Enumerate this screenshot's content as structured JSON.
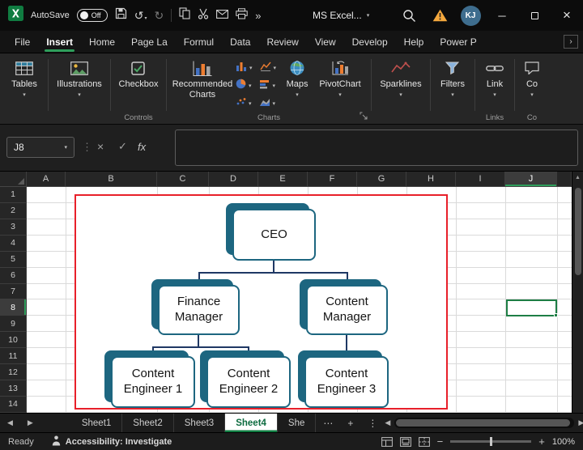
{
  "colors": {
    "excel_green": "#107C41",
    "accent_green": "#2e9e5b",
    "smartart_teal": "#1d6680",
    "connector_blue": "#1f3864",
    "selection_red": "#e8202a",
    "warning_orange": "#f4a83d"
  },
  "icons": {
    "chevron_down": "▾",
    "chevron_right": "›",
    "more_commands": "»",
    "undo": "↺",
    "redo": "↻",
    "minimize": "─",
    "close": "×",
    "cancel": "×",
    "check": "✓",
    "dots_vertical": "⋮",
    "ellipsis": "⋯",
    "plus": "+",
    "minus": "−",
    "tri_left": "◀",
    "tri_right": "▶",
    "tri_up": "▲"
  },
  "titlebar": {
    "autosave_label": "AutoSave",
    "autosave_state": "Off",
    "title": "MS Excel...",
    "avatar_initials": "KJ"
  },
  "ribbon_tabs": {
    "items": [
      "File",
      "Insert",
      "Home",
      "Page La",
      "Formul",
      "Data",
      "Review",
      "View",
      "Develop",
      "Help",
      "Power P"
    ],
    "active": "Insert"
  },
  "ribbon": {
    "tables": "Tables",
    "illustrations": "Illustrations",
    "checkbox": "Checkbox",
    "recommended_charts": "Recommended Charts",
    "maps": "Maps",
    "pivotchart": "PivotChart",
    "sparklines": "Sparklines",
    "filters": "Filters",
    "link": "Link",
    "comments": "Co",
    "group_controls": "Controls",
    "group_charts": "Charts",
    "group_links": "Links",
    "group_comments": "Co"
  },
  "formula_bar": {
    "name_box": "J8",
    "fx_label": "fx"
  },
  "grid": {
    "columns": [
      "A",
      "B",
      "C",
      "D",
      "E",
      "F",
      "G",
      "H",
      "I",
      "J"
    ],
    "rows": [
      "1",
      "2",
      "3",
      "4",
      "5",
      "6",
      "7",
      "8",
      "9",
      "10",
      "11",
      "12",
      "13",
      "14"
    ],
    "selected_cell": "J8"
  },
  "org_chart": {
    "nodes": [
      "CEO",
      "Finance Manager",
      "Content Manager",
      "Content Engineer 1",
      "Content Engineer 2",
      "Content Engineer 3"
    ]
  },
  "sheet_bar": {
    "tabs": [
      "Sheet1",
      "Sheet2",
      "Sheet3",
      "Sheet4",
      "She"
    ],
    "active": "Sheet4"
  },
  "status_bar": {
    "ready": "Ready",
    "accessibility": "Accessibility: Investigate",
    "zoom": "100%"
  }
}
